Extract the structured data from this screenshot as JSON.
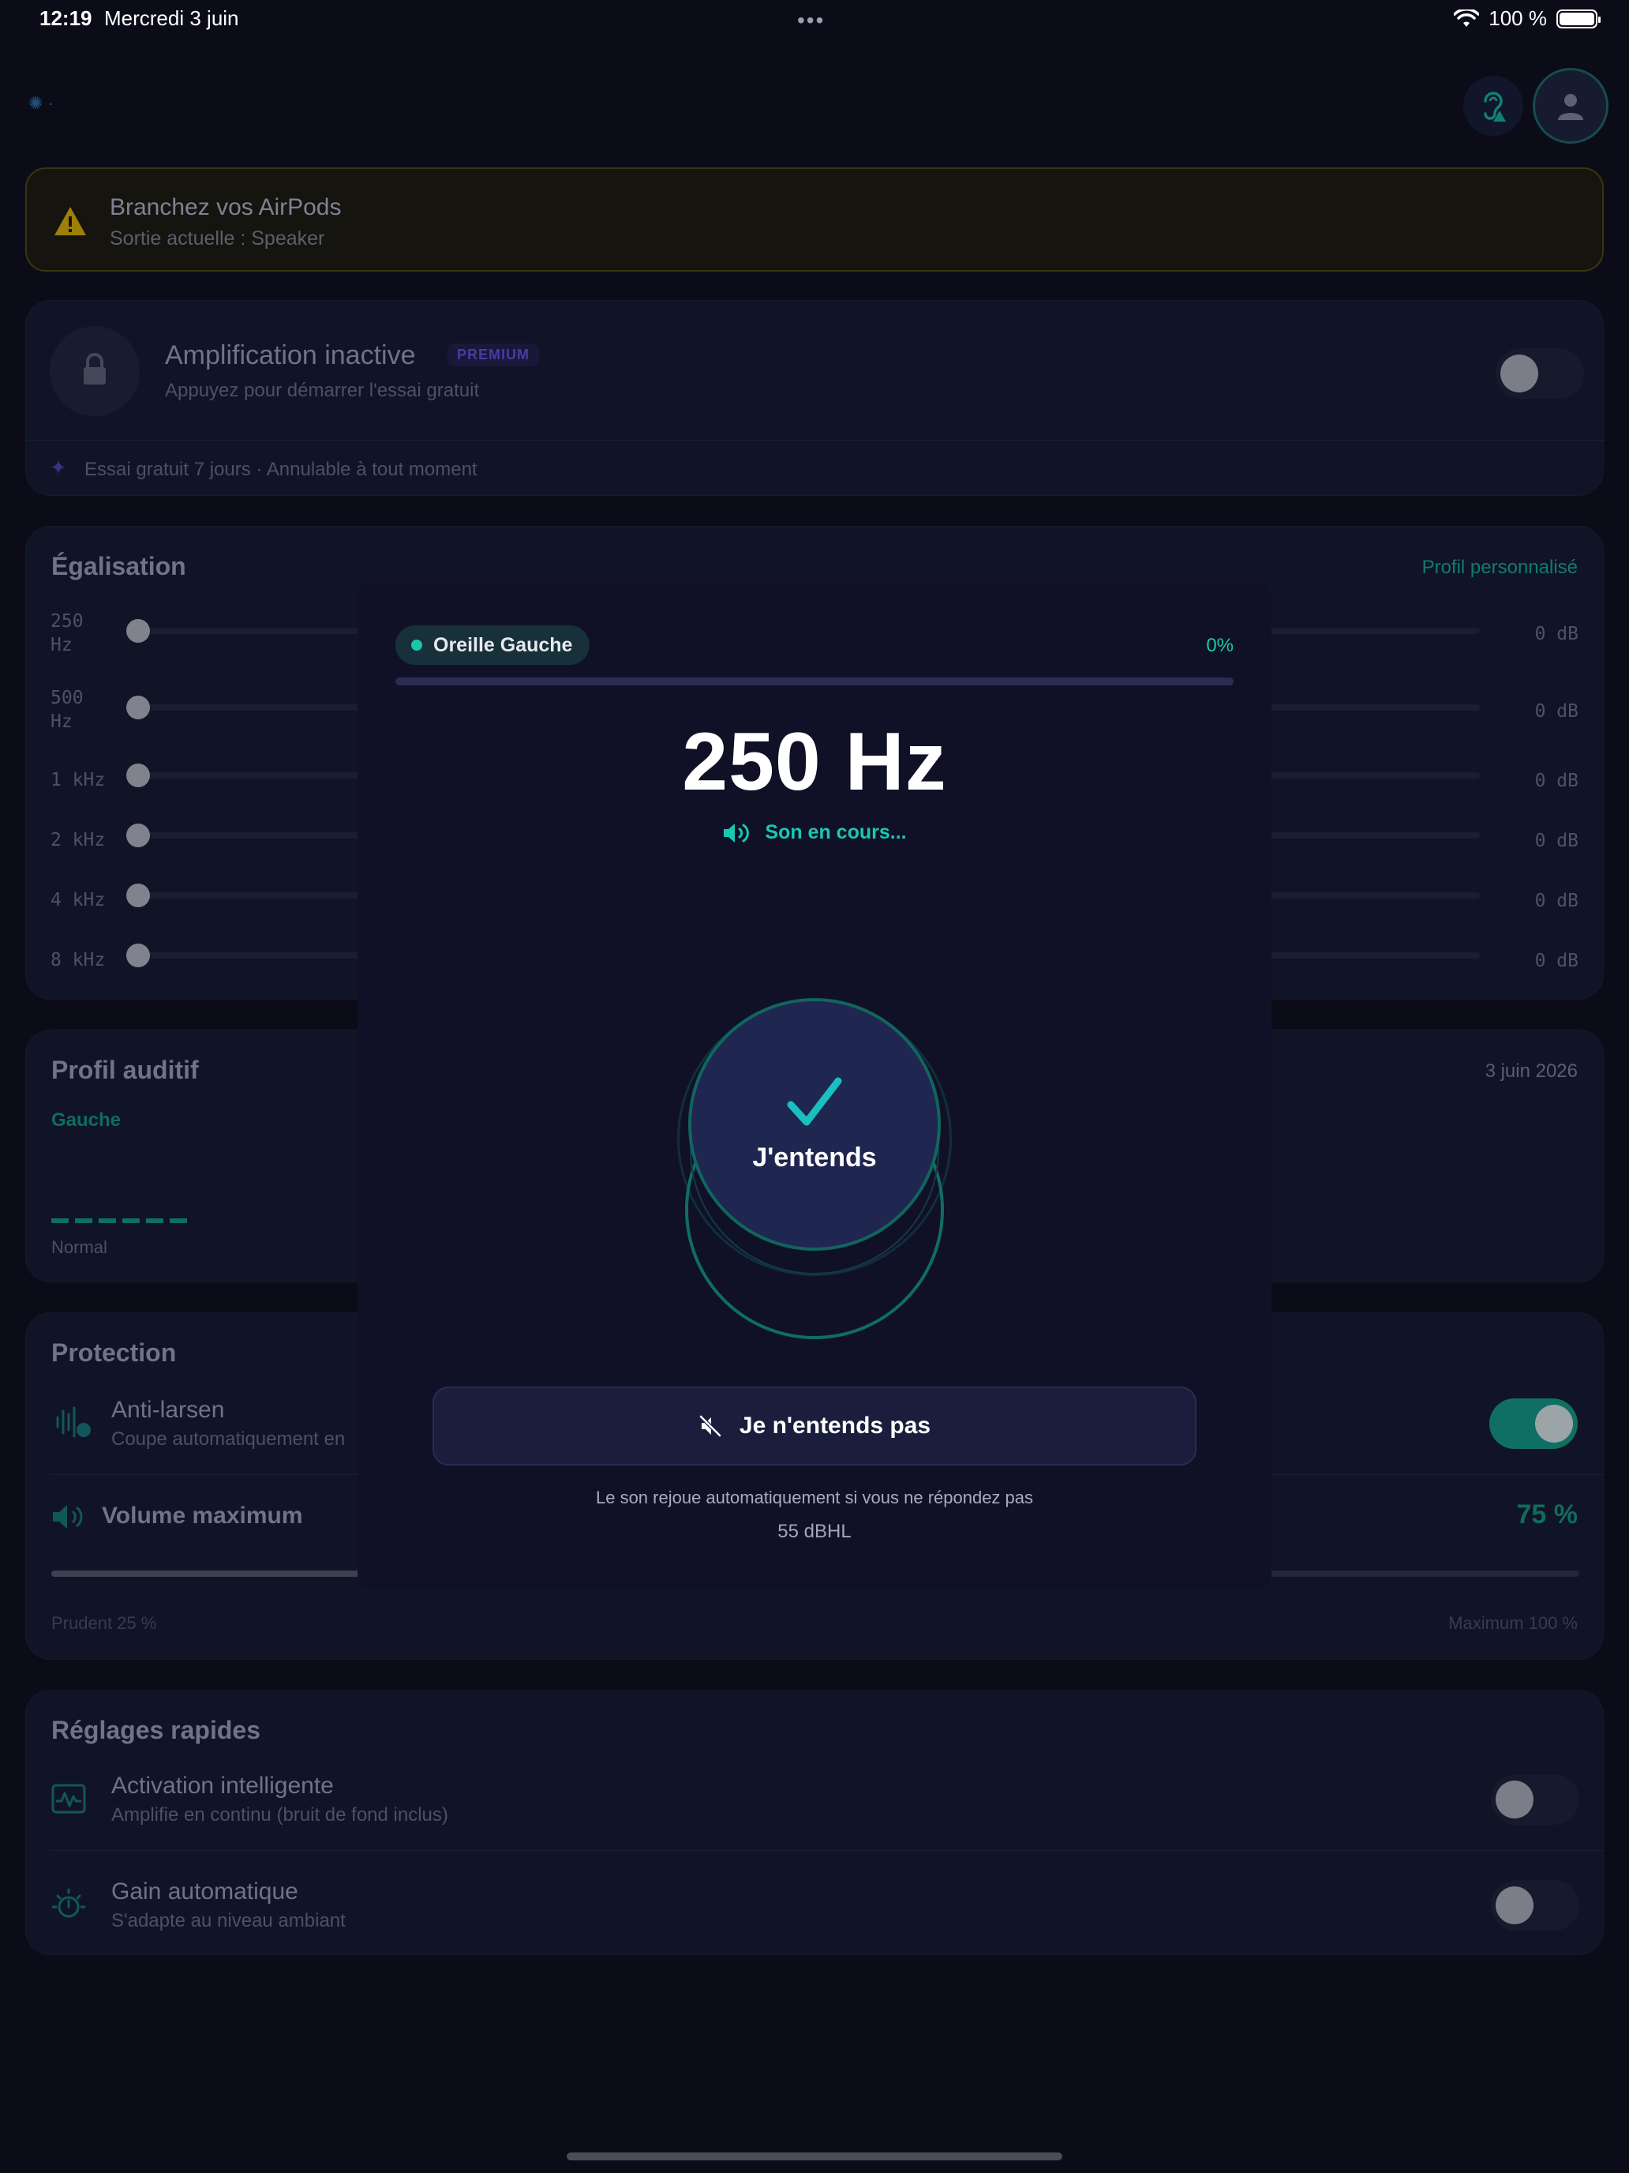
{
  "status_bar": {
    "time": "12:19",
    "date": "Mercredi 3 juin",
    "battery": "100 %"
  },
  "warning": {
    "title": "Branchez vos AirPods",
    "subtitle": "Sortie actuelle : Speaker"
  },
  "amplification": {
    "title": "Amplification inactive",
    "badge": "PREMIUM",
    "subtitle": "Appuyez pour démarrer l'essai gratuit",
    "trial_note": "Essai gratuit 7 jours · Annulable à tout moment",
    "enabled": false
  },
  "equalization": {
    "title": "Égalisation",
    "profile_link": "Profil personnalisé",
    "bands": [
      {
        "label_line1": "250",
        "label_line2": "Hz",
        "value": "0 dB"
      },
      {
        "label_line1": "500",
        "label_line2": "Hz",
        "value": "0 dB"
      },
      {
        "label_line1": "1 kHz",
        "label_line2": "",
        "value": "0 dB"
      },
      {
        "label_line1": "2 kHz",
        "label_line2": "",
        "value": "0 dB"
      },
      {
        "label_line1": "4 kHz",
        "label_line2": "",
        "value": "0 dB"
      },
      {
        "label_line1": "8 kHz",
        "label_line2": "",
        "value": "0 dB"
      }
    ]
  },
  "hearing_profile": {
    "title": "Profil auditif",
    "date": "3 juin 2026",
    "ear": "Gauche",
    "level": "Normal"
  },
  "protection": {
    "title": "Protection",
    "anti_feedback_title": "Anti-larsen",
    "anti_feedback_sub": "Coupe automatiquement en",
    "anti_feedback_enabled": true,
    "max_volume_title": "Volume maximum",
    "max_volume_value": "75 %",
    "max_volume_fraction": 0.75,
    "min_label": "Prudent 25 %",
    "max_label": "Maximum 100 %"
  },
  "quick_settings": {
    "title": "Réglages rapides",
    "items": [
      {
        "title": "Activation intelligente",
        "subtitle": "Amplifie en continu (bruit de fond inclus)",
        "enabled": false
      },
      {
        "title": "Gain automatique",
        "subtitle": "S'adapte au niveau ambiant",
        "enabled": false
      }
    ]
  },
  "test_modal": {
    "ear_label": "Oreille Gauche",
    "progress_text": "0%",
    "progress_fraction": 0,
    "frequency": "250 Hz",
    "status": "Son en cours...",
    "hear_button": "J'entends",
    "not_hear_button": "Je n'entends pas",
    "replay_note": "Le son rejoue automatiquement si vous ne répondez pas",
    "level": "55 dBHL"
  },
  "colors": {
    "accent": "#19c7a9",
    "background": "#0b0c18",
    "modal": "#101126",
    "warning": "#c9a20c",
    "premium": "#5b3fd0"
  }
}
